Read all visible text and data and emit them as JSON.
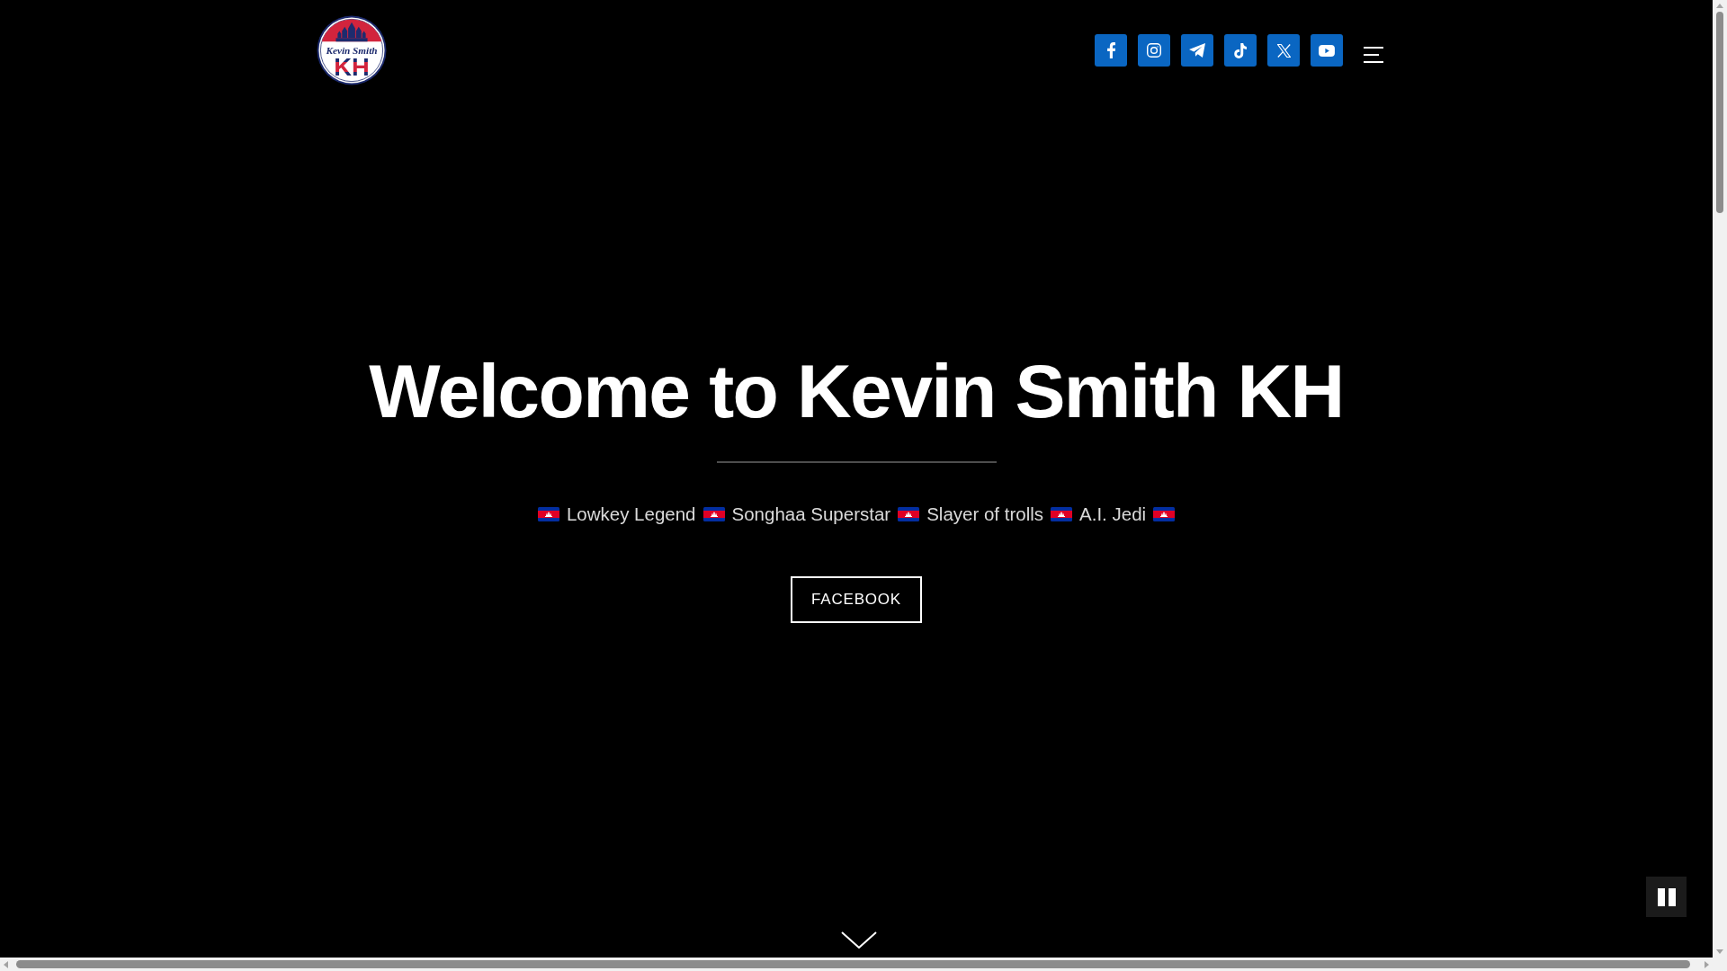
{
  "header": {
    "logo": {
      "script_text": "Kevin Smith",
      "letters": "KH"
    },
    "social_links": [
      {
        "kind": "facebook"
      },
      {
        "kind": "instagram"
      },
      {
        "kind": "telegram"
      },
      {
        "kind": "tiktok"
      },
      {
        "kind": "x"
      },
      {
        "kind": "youtube"
      }
    ]
  },
  "hero": {
    "title": "Welcome to Kevin Smith KH",
    "tagline": [
      "Lowkey Legend",
      "Songhaa Superstar",
      "Slayer of trolls",
      "A.I. Jedi"
    ],
    "button": "FACEBOOK"
  },
  "video_control": {
    "playing": true
  }
}
